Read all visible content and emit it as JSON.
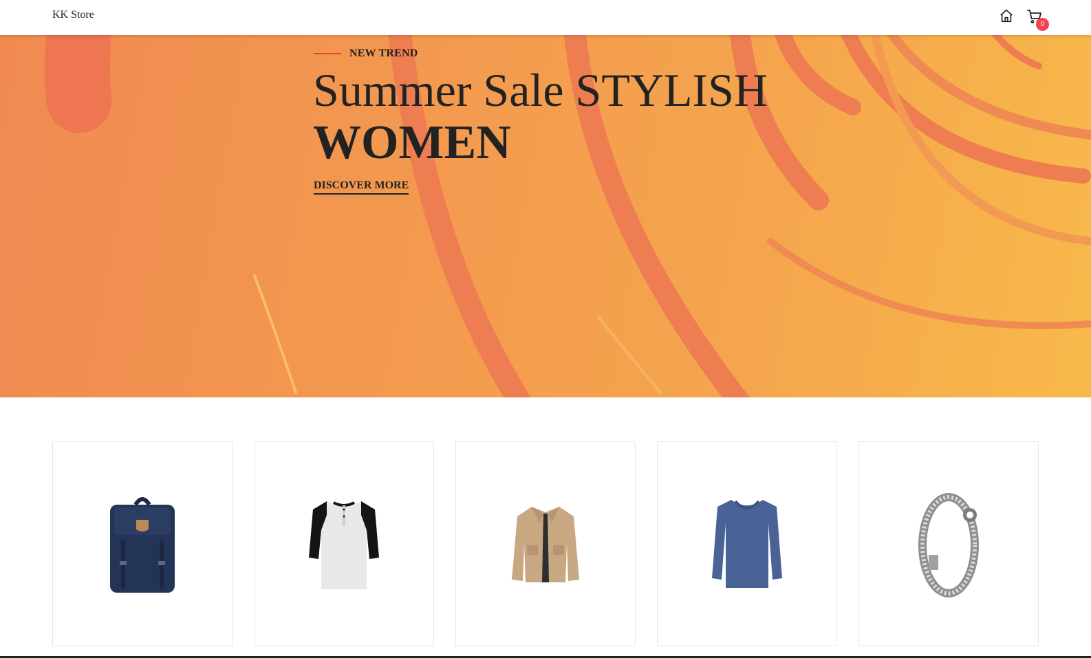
{
  "header": {
    "brand": "KK Store",
    "icons": [
      "home-icon",
      "cart-icon"
    ],
    "cart_count": "0"
  },
  "hero": {
    "eyebrow": "NEW TREND",
    "title_line1": "Summer Sale STYLISH",
    "title_line2": "WOMEN",
    "cta": "DISCOVER MORE"
  },
  "products": [
    {
      "name": "backpack",
      "icon": "backpack-image"
    },
    {
      "name": "raglan henley t-shirt",
      "icon": "tshirt-image"
    },
    {
      "name": "beige jacket",
      "icon": "jacket-image"
    },
    {
      "name": "blue long sleeve shirt",
      "icon": "longsleeve-image"
    },
    {
      "name": "silver dragon bracelet",
      "icon": "bracelet-image"
    }
  ],
  "colors": {
    "accent_red": "#e8423d",
    "badge": "#f0434f",
    "hero_start": "#f08a51",
    "hero_end": "#f8b94a",
    "text": "#222222"
  }
}
